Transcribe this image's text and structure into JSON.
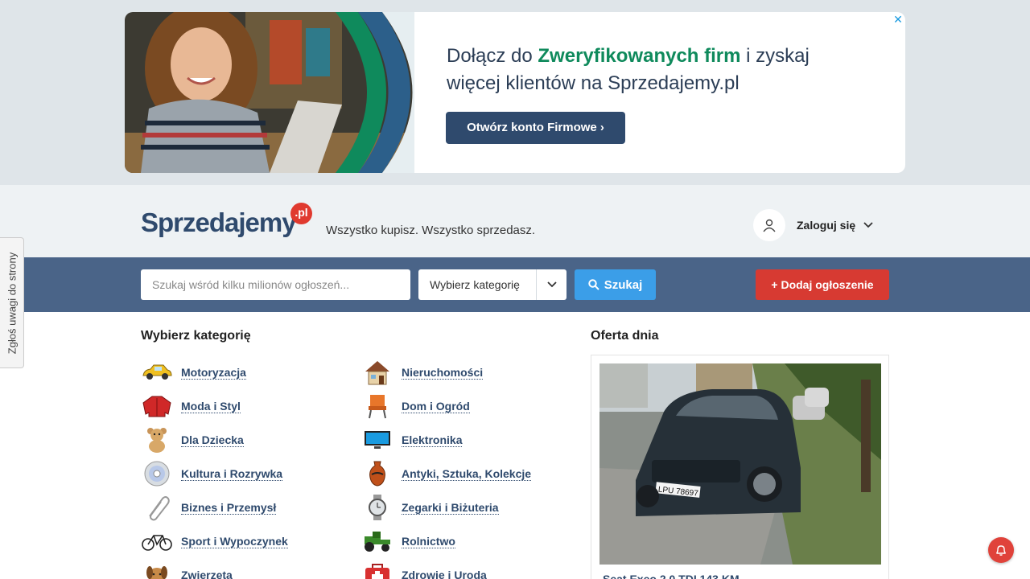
{
  "ad": {
    "text_before": "Dołącz do ",
    "text_highlight": "Zweryfikowanych firm",
    "text_after": " i zyskaj więcej klientów na Sprzedajemy.pl",
    "cta_label": "Otwórz konto Firmowe ›",
    "close_label": "✕"
  },
  "header": {
    "logo_text": "Sprzedajemy",
    "logo_badge": ".pl",
    "tagline": "Wszystko kupisz. Wszystko sprzedasz.",
    "login_label": "Zaloguj się"
  },
  "search": {
    "placeholder": "Szukaj wśród kilku milionów ogłoszeń...",
    "category_label": "Wybierz kategorię",
    "search_button": "Szukaj",
    "add_button": "+ Dodaj ogłoszenie"
  },
  "feedback": {
    "label": "Zgłoś uwagi do strony"
  },
  "categories": {
    "title": "Wybierz kategorię",
    "items": [
      {
        "label": "Motoryzacja",
        "icon": "car-icon"
      },
      {
        "label": "Nieruchomości",
        "icon": "house-icon"
      },
      {
        "label": "Moda i Styl",
        "icon": "jacket-icon"
      },
      {
        "label": "Dom i Ogród",
        "icon": "chair-icon"
      },
      {
        "label": "Dla Dziecka",
        "icon": "teddy-bear-icon"
      },
      {
        "label": "Elektronika",
        "icon": "tv-icon"
      },
      {
        "label": "Kultura i Rozrywka",
        "icon": "cd-icon"
      },
      {
        "label": "Antyki, Sztuka, Kolekcje",
        "icon": "vase-icon"
      },
      {
        "label": "Biznes i Przemysł",
        "icon": "paperclip-icon"
      },
      {
        "label": "Zegarki i Biżuteria",
        "icon": "watch-icon"
      },
      {
        "label": "Sport i Wypoczynek",
        "icon": "bicycle-icon"
      },
      {
        "label": "Rolnictwo",
        "icon": "tractor-icon"
      },
      {
        "label": "Zwierzęta",
        "icon": "dog-icon"
      },
      {
        "label": "Zdrowie i Uroda",
        "icon": "first-aid-icon"
      }
    ]
  },
  "deal": {
    "title": "Oferta dnia",
    "caption": "Seat Exeo 2.0 TDI 143 KM",
    "plate": "LPU 78697"
  },
  "colors": {
    "brand_navy": "#2f4a6d",
    "search_bar": "#4a6488",
    "search_button": "#3b9ee8",
    "add_button": "#d73a32",
    "ad_highlight": "#0f8a5c"
  }
}
